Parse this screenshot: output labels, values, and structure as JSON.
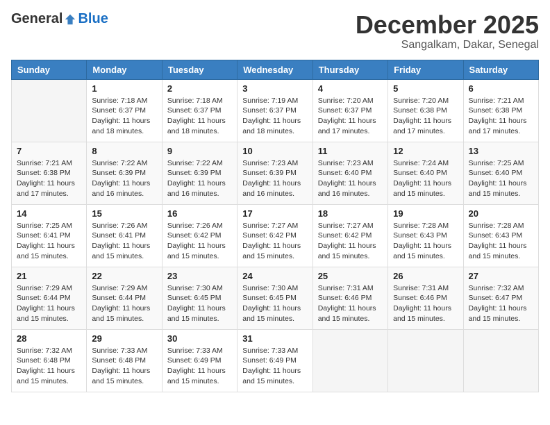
{
  "logo": {
    "general": "General",
    "blue": "Blue"
  },
  "header": {
    "month": "December 2025",
    "location": "Sangalkam, Dakar, Senegal"
  },
  "weekdays": [
    "Sunday",
    "Monday",
    "Tuesday",
    "Wednesday",
    "Thursday",
    "Friday",
    "Saturday"
  ],
  "weeks": [
    [
      {
        "day": "",
        "sunrise": "",
        "sunset": "",
        "daylight": ""
      },
      {
        "day": "1",
        "sunrise": "Sunrise: 7:18 AM",
        "sunset": "Sunset: 6:37 PM",
        "daylight": "Daylight: 11 hours and 18 minutes."
      },
      {
        "day": "2",
        "sunrise": "Sunrise: 7:18 AM",
        "sunset": "Sunset: 6:37 PM",
        "daylight": "Daylight: 11 hours and 18 minutes."
      },
      {
        "day": "3",
        "sunrise": "Sunrise: 7:19 AM",
        "sunset": "Sunset: 6:37 PM",
        "daylight": "Daylight: 11 hours and 18 minutes."
      },
      {
        "day": "4",
        "sunrise": "Sunrise: 7:20 AM",
        "sunset": "Sunset: 6:37 PM",
        "daylight": "Daylight: 11 hours and 17 minutes."
      },
      {
        "day": "5",
        "sunrise": "Sunrise: 7:20 AM",
        "sunset": "Sunset: 6:38 PM",
        "daylight": "Daylight: 11 hours and 17 minutes."
      },
      {
        "day": "6",
        "sunrise": "Sunrise: 7:21 AM",
        "sunset": "Sunset: 6:38 PM",
        "daylight": "Daylight: 11 hours and 17 minutes."
      }
    ],
    [
      {
        "day": "7",
        "sunrise": "Sunrise: 7:21 AM",
        "sunset": "Sunset: 6:38 PM",
        "daylight": "Daylight: 11 hours and 17 minutes."
      },
      {
        "day": "8",
        "sunrise": "Sunrise: 7:22 AM",
        "sunset": "Sunset: 6:39 PM",
        "daylight": "Daylight: 11 hours and 16 minutes."
      },
      {
        "day": "9",
        "sunrise": "Sunrise: 7:22 AM",
        "sunset": "Sunset: 6:39 PM",
        "daylight": "Daylight: 11 hours and 16 minutes."
      },
      {
        "day": "10",
        "sunrise": "Sunrise: 7:23 AM",
        "sunset": "Sunset: 6:39 PM",
        "daylight": "Daylight: 11 hours and 16 minutes."
      },
      {
        "day": "11",
        "sunrise": "Sunrise: 7:23 AM",
        "sunset": "Sunset: 6:40 PM",
        "daylight": "Daylight: 11 hours and 16 minutes."
      },
      {
        "day": "12",
        "sunrise": "Sunrise: 7:24 AM",
        "sunset": "Sunset: 6:40 PM",
        "daylight": "Daylight: 11 hours and 15 minutes."
      },
      {
        "day": "13",
        "sunrise": "Sunrise: 7:25 AM",
        "sunset": "Sunset: 6:40 PM",
        "daylight": "Daylight: 11 hours and 15 minutes."
      }
    ],
    [
      {
        "day": "14",
        "sunrise": "Sunrise: 7:25 AM",
        "sunset": "Sunset: 6:41 PM",
        "daylight": "Daylight: 11 hours and 15 minutes."
      },
      {
        "day": "15",
        "sunrise": "Sunrise: 7:26 AM",
        "sunset": "Sunset: 6:41 PM",
        "daylight": "Daylight: 11 hours and 15 minutes."
      },
      {
        "day": "16",
        "sunrise": "Sunrise: 7:26 AM",
        "sunset": "Sunset: 6:42 PM",
        "daylight": "Daylight: 11 hours and 15 minutes."
      },
      {
        "day": "17",
        "sunrise": "Sunrise: 7:27 AM",
        "sunset": "Sunset: 6:42 PM",
        "daylight": "Daylight: 11 hours and 15 minutes."
      },
      {
        "day": "18",
        "sunrise": "Sunrise: 7:27 AM",
        "sunset": "Sunset: 6:42 PM",
        "daylight": "Daylight: 11 hours and 15 minutes."
      },
      {
        "day": "19",
        "sunrise": "Sunrise: 7:28 AM",
        "sunset": "Sunset: 6:43 PM",
        "daylight": "Daylight: 11 hours and 15 minutes."
      },
      {
        "day": "20",
        "sunrise": "Sunrise: 7:28 AM",
        "sunset": "Sunset: 6:43 PM",
        "daylight": "Daylight: 11 hours and 15 minutes."
      }
    ],
    [
      {
        "day": "21",
        "sunrise": "Sunrise: 7:29 AM",
        "sunset": "Sunset: 6:44 PM",
        "daylight": "Daylight: 11 hours and 15 minutes."
      },
      {
        "day": "22",
        "sunrise": "Sunrise: 7:29 AM",
        "sunset": "Sunset: 6:44 PM",
        "daylight": "Daylight: 11 hours and 15 minutes."
      },
      {
        "day": "23",
        "sunrise": "Sunrise: 7:30 AM",
        "sunset": "Sunset: 6:45 PM",
        "daylight": "Daylight: 11 hours and 15 minutes."
      },
      {
        "day": "24",
        "sunrise": "Sunrise: 7:30 AM",
        "sunset": "Sunset: 6:45 PM",
        "daylight": "Daylight: 11 hours and 15 minutes."
      },
      {
        "day": "25",
        "sunrise": "Sunrise: 7:31 AM",
        "sunset": "Sunset: 6:46 PM",
        "daylight": "Daylight: 11 hours and 15 minutes."
      },
      {
        "day": "26",
        "sunrise": "Sunrise: 7:31 AM",
        "sunset": "Sunset: 6:46 PM",
        "daylight": "Daylight: 11 hours and 15 minutes."
      },
      {
        "day": "27",
        "sunrise": "Sunrise: 7:32 AM",
        "sunset": "Sunset: 6:47 PM",
        "daylight": "Daylight: 11 hours and 15 minutes."
      }
    ],
    [
      {
        "day": "28",
        "sunrise": "Sunrise: 7:32 AM",
        "sunset": "Sunset: 6:48 PM",
        "daylight": "Daylight: 11 hours and 15 minutes."
      },
      {
        "day": "29",
        "sunrise": "Sunrise: 7:33 AM",
        "sunset": "Sunset: 6:48 PM",
        "daylight": "Daylight: 11 hours and 15 minutes."
      },
      {
        "day": "30",
        "sunrise": "Sunrise: 7:33 AM",
        "sunset": "Sunset: 6:49 PM",
        "daylight": "Daylight: 11 hours and 15 minutes."
      },
      {
        "day": "31",
        "sunrise": "Sunrise: 7:33 AM",
        "sunset": "Sunset: 6:49 PM",
        "daylight": "Daylight: 11 hours and 15 minutes."
      },
      {
        "day": "",
        "sunrise": "",
        "sunset": "",
        "daylight": ""
      },
      {
        "day": "",
        "sunrise": "",
        "sunset": "",
        "daylight": ""
      },
      {
        "day": "",
        "sunrise": "",
        "sunset": "",
        "daylight": ""
      }
    ]
  ]
}
